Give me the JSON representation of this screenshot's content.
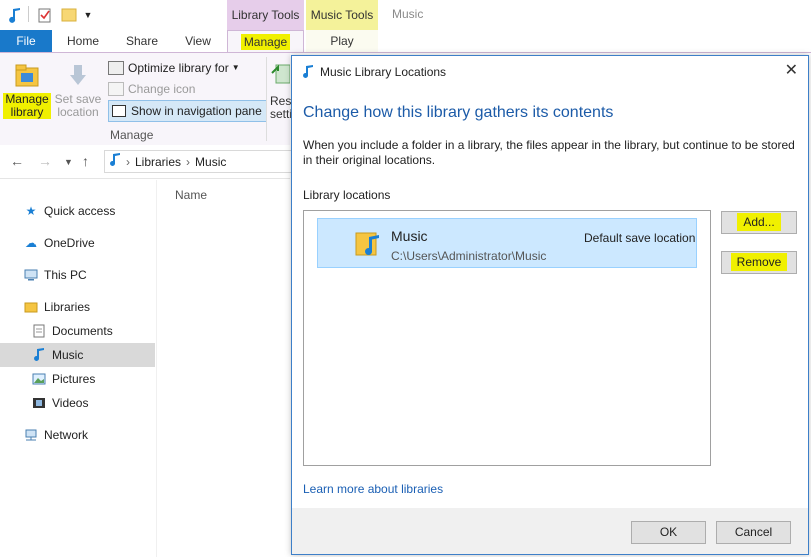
{
  "titlebar": {
    "window_title": "Music",
    "contextual_tabs": {
      "library_tools": "Library Tools",
      "music_tools": "Music Tools"
    }
  },
  "ribbon": {
    "tabs": {
      "file": "File",
      "home": "Home",
      "share": "Share",
      "view": "View",
      "manage": "Manage",
      "play": "Play"
    },
    "manage_library": "Manage library",
    "set_save_location": "Set save location",
    "optimize_library_for": "Optimize library for",
    "change_icon": "Change icon",
    "show_in_nav_pane": "Show in navigation pane",
    "group_manage": "Manage",
    "reset_settings": "Reset settings"
  },
  "address": {
    "path": [
      "Libraries",
      "Music"
    ]
  },
  "nav": {
    "quick_access": "Quick access",
    "onedrive": "OneDrive",
    "this_pc": "This PC",
    "libraries": "Libraries",
    "documents": "Documents",
    "music": "Music",
    "pictures": "Pictures",
    "videos": "Videos",
    "network": "Network"
  },
  "filelist": {
    "col_name": "Name"
  },
  "dialog": {
    "title": "Music Library Locations",
    "heading": "Change how this library gathers its contents",
    "description": "When you include a folder in a library, the files appear in the library, but continue to be stored in their original locations.",
    "locations_label": "Library locations",
    "location": {
      "name": "Music",
      "path": "C:\\Users\\Administrator\\Music",
      "default_text": "Default save location"
    },
    "add": "Add...",
    "remove": "Remove",
    "learn_more": "Learn more about libraries",
    "ok": "OK",
    "cancel": "Cancel"
  },
  "colors": {
    "accent": "#1979ca",
    "highlight": "#f0f000",
    "library_tools": "#e6cdea",
    "music_tools": "#f4f29a",
    "selection": "#cce8ff",
    "link": "#1a5fb4"
  }
}
